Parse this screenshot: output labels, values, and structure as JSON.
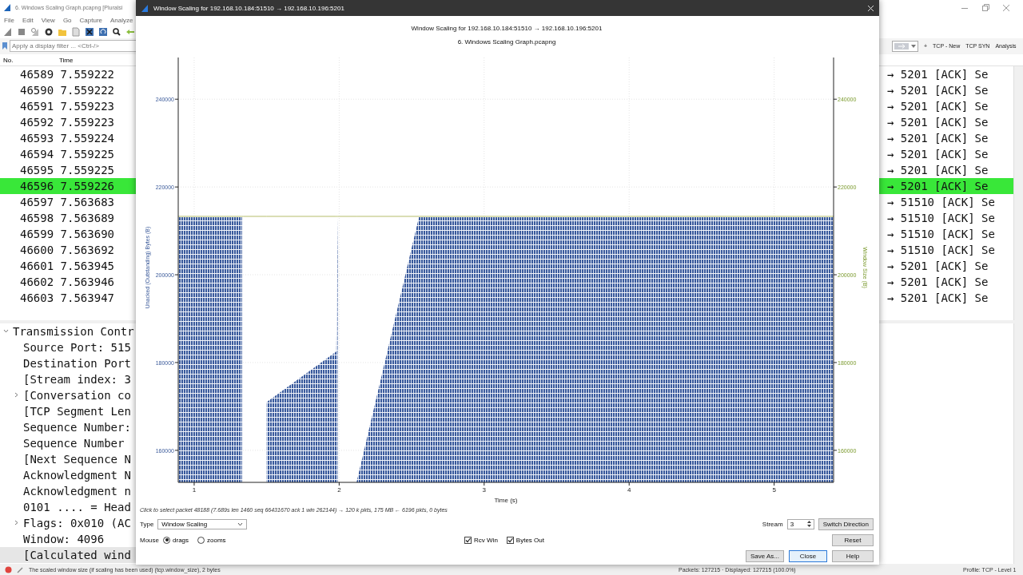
{
  "main_window": {
    "title": "6. Windows Scaling Graph.pcapng [Pluralsi",
    "menu": [
      "File",
      "Edit",
      "View",
      "Go",
      "Capture",
      "Analyze"
    ],
    "display_filter": {
      "placeholder": "Apply a display filter ... <Ctrl-/>"
    },
    "filter_buttons": [
      "+",
      "TCP - New",
      "TCP SYN",
      "Analysis"
    ],
    "packet_list": {
      "columns": [
        "No.",
        "Time"
      ],
      "rows": [
        {
          "no": "46589",
          "time": "7.559222",
          "info": "→ 5201 [ACK] Se",
          "selected": false
        },
        {
          "no": "46590",
          "time": "7.559222",
          "info": "→ 5201 [ACK] Se",
          "selected": false
        },
        {
          "no": "46591",
          "time": "7.559223",
          "info": "→ 5201 [ACK] Se",
          "selected": false
        },
        {
          "no": "46592",
          "time": "7.559223",
          "info": "→ 5201 [ACK] Se",
          "selected": false
        },
        {
          "no": "46593",
          "time": "7.559224",
          "info": "→ 5201 [ACK] Se",
          "selected": false
        },
        {
          "no": "46594",
          "time": "7.559225",
          "info": "→ 5201 [ACK] Se",
          "selected": false
        },
        {
          "no": "46595",
          "time": "7.559225",
          "info": "→ 5201 [ACK] Se",
          "selected": false
        },
        {
          "no": "46596",
          "time": "7.559226",
          "info": "→ 5201 [ACK] Se",
          "selected": true
        },
        {
          "no": "46597",
          "time": "7.563683",
          "info": "→ 51510 [ACK] Se",
          "selected": false
        },
        {
          "no": "46598",
          "time": "7.563689",
          "info": "→ 51510 [ACK] Se",
          "selected": false
        },
        {
          "no": "46599",
          "time": "7.563690",
          "info": "→ 51510 [ACK] Se",
          "selected": false
        },
        {
          "no": "46600",
          "time": "7.563692",
          "info": "→ 51510 [ACK] Se",
          "selected": false
        },
        {
          "no": "46601",
          "time": "7.563945",
          "info": "→ 5201 [ACK] Se",
          "selected": false
        },
        {
          "no": "46602",
          "time": "7.563946",
          "info": "→ 5201 [ACK] Se",
          "selected": false
        },
        {
          "no": "46603",
          "time": "7.563947",
          "info": "→ 5201 [ACK] Se",
          "selected": false
        }
      ]
    },
    "detail_tree": [
      {
        "label": "Transmission Contr",
        "kind": "group",
        "expanded": true,
        "selected": false,
        "children": [
          {
            "label": "Source Port: 515",
            "kind": "field",
            "selected": false
          },
          {
            "label": "Destination Port",
            "kind": "field",
            "selected": false
          },
          {
            "label": "[Stream index: 3",
            "kind": "field",
            "selected": false
          },
          {
            "label": "[Conversation co",
            "kind": "group",
            "expanded": false,
            "selected": false
          },
          {
            "label": "[TCP Segment Len",
            "kind": "field",
            "selected": false
          },
          {
            "label": "Sequence Number:",
            "kind": "field",
            "selected": false
          },
          {
            "label": "Sequence Number",
            "kind": "field",
            "selected": false
          },
          {
            "label": "[Next Sequence N",
            "kind": "field",
            "selected": false
          },
          {
            "label": "Acknowledgment N",
            "kind": "field",
            "selected": false
          },
          {
            "label": "Acknowledgment n",
            "kind": "field",
            "selected": false
          },
          {
            "label": "0101 .... = Head",
            "kind": "field",
            "selected": false
          },
          {
            "label": "Flags: 0x010 (AC",
            "kind": "group",
            "expanded": false,
            "selected": false
          },
          {
            "label": "Window: 4096",
            "kind": "field",
            "selected": false
          },
          {
            "label": "[Calculated wind",
            "kind": "field",
            "selected": true
          }
        ]
      }
    ],
    "status_bar": {
      "hint": "The scaled window size (if scaling has been used) (tcp.window_size), 2 bytes",
      "packets": "Packets: 127215 · Displayed: 127215 (100.0%)",
      "profile": "Profile: TCP - Level 1"
    }
  },
  "dialog": {
    "title": "Window Scaling for 192.168.10.184:51510 → 192.168.10.196:5201",
    "graph": {
      "subtitle": "6. Windows Scaling Graph.pcapng",
      "right_axis": {
        "label": "Window Size (B)",
        "ticks": [
          "240000",
          "220000",
          "200000",
          "180000",
          "160000"
        ]
      },
      "chart_data": {
        "type": "line",
        "title": "Window Scaling for 192.168.10.184:51510 → 192.168.10.196:5201",
        "xlabel": "Time (s)",
        "ylabel": "Unacked (Outstanding) Bytes (B)",
        "x": [
          0.89,
          1.33,
          1.34,
          1.5,
          1.98,
          1.99,
          2.0,
          2.12,
          2.55,
          5.41
        ],
        "series": [
          {
            "name": "Rcv Win",
            "color": "#b5bd6a",
            "values": [
              213300,
              213300,
              213300,
              213300,
              213300,
              213300,
              213300,
              213300,
              213300,
              213300
            ]
          },
          {
            "name": "Bytes Out",
            "color": "#3a5a9c",
            "type": "area",
            "values": [
              213100,
              213100,
              null,
              171000,
              182500,
              213100,
              null,
              152700,
              213100,
              213100
            ]
          }
        ],
        "grid": true,
        "xlim": [
          0.89,
          5.41
        ],
        "ylim": [
          152700,
          249500
        ],
        "xticks": [
          1,
          2,
          3,
          4,
          5
        ],
        "yticks": [
          {
            "value": 160000,
            "label": "160000"
          },
          {
            "value": 180000,
            "label": "180000"
          },
          {
            "value": 200000,
            "label": "200000"
          },
          {
            "value": 220000,
            "label": "220000"
          },
          {
            "value": 240000,
            "label": "240000"
          }
        ]
      }
    },
    "hint": "Click to select packet 48188 (7.689s len 1460 seq 66431670 ack 1 win 262144) → 120 k pkts, 175 MB ← 6196 pkts, 0 bytes",
    "type": {
      "label": "Type",
      "value": "Window Scaling"
    },
    "stream": {
      "label": "Stream",
      "value": "3"
    },
    "mouse": {
      "label": "Mouse",
      "options": [
        {
          "label": "drags",
          "selected": true
        },
        {
          "label": "zooms",
          "selected": false
        }
      ]
    },
    "checkboxes": [
      {
        "checked": true
      },
      {
        "checked": true
      }
    ],
    "buttons": {
      "switch": "Switch Direction",
      "reset": "Reset",
      "save": "Save As...",
      "close": "Close",
      "help": "Help"
    }
  }
}
